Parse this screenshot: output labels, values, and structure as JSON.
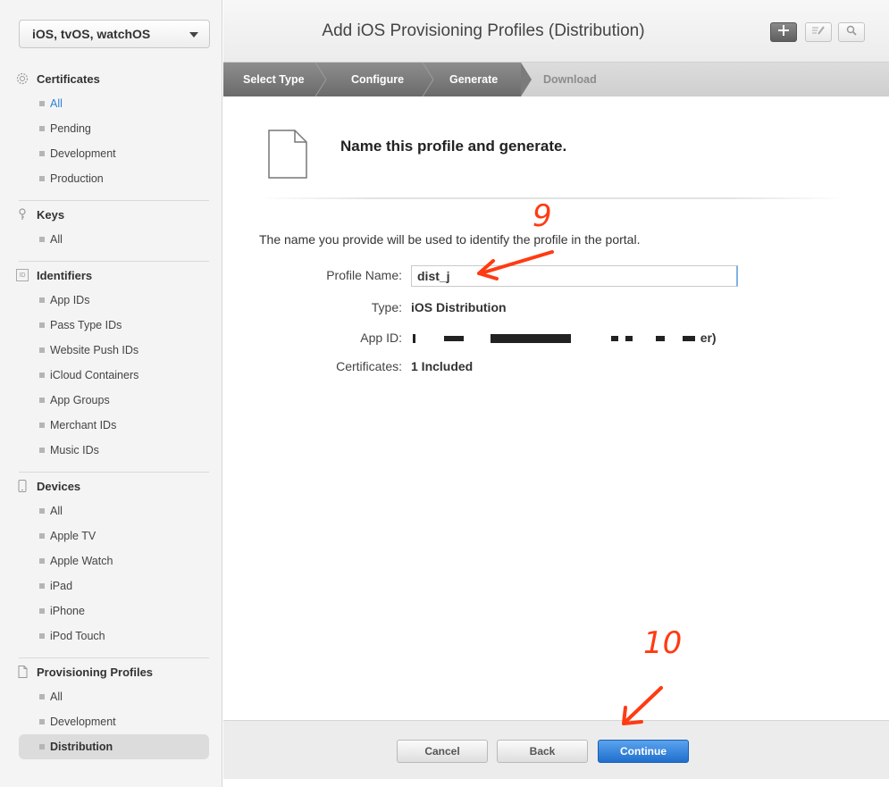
{
  "platform": {
    "selected": "iOS, tvOS, watchOS"
  },
  "sidebar": {
    "certificates": {
      "title": "Certificates",
      "items": [
        "All",
        "Pending",
        "Development",
        "Production"
      ]
    },
    "keys": {
      "title": "Keys",
      "items": [
        "All"
      ]
    },
    "identifiers": {
      "title": "Identifiers",
      "icon_text": "ID",
      "items": [
        "App IDs",
        "Pass Type IDs",
        "Website Push IDs",
        "iCloud Containers",
        "App Groups",
        "Merchant IDs",
        "Music IDs"
      ]
    },
    "devices": {
      "title": "Devices",
      "items": [
        "All",
        "Apple TV",
        "Apple Watch",
        "iPad",
        "iPhone",
        "iPod Touch"
      ]
    },
    "profiles": {
      "title": "Provisioning Profiles",
      "items": [
        "All",
        "Development",
        "Distribution"
      ]
    }
  },
  "header": {
    "title": "Add iOS Provisioning Profiles (Distribution)"
  },
  "steps": [
    "Select Type",
    "Configure",
    "Generate",
    "Download"
  ],
  "main": {
    "heading": "Name this profile and generate.",
    "description": "The name you provide will be used to identify the profile in the portal.",
    "profile_name_label": "Profile Name:",
    "profile_name_value": "dist_j",
    "type_label": "Type:",
    "type_value": "iOS Distribution",
    "app_id_label": "App ID:",
    "app_id_value_end": "er)",
    "certificates_label": "Certificates:",
    "certificates_value": "1 Included"
  },
  "footer": {
    "cancel": "Cancel",
    "back": "Back",
    "continue": "Continue"
  },
  "annotations": {
    "step9": "9",
    "step10": "10"
  },
  "colors": {
    "accent": "#1f6fcd",
    "link": "#2a84d4",
    "annotation": "#ff3b12"
  }
}
